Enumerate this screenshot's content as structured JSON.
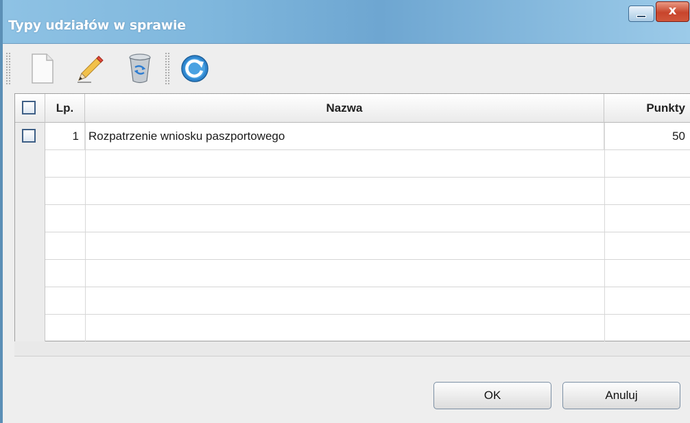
{
  "window": {
    "title": "Typy udziałów w sprawie",
    "close_glyph": "x"
  },
  "toolbar": {
    "buttons": [
      {
        "icon": "new-document-icon"
      },
      {
        "icon": "edit-pencil-icon"
      },
      {
        "icon": "recycle-bin-icon"
      },
      {
        "icon": "refresh-icon"
      }
    ]
  },
  "table": {
    "columns": [
      "Lp.",
      "Nazwa",
      "Punkty"
    ],
    "rows": [
      {
        "lp": "1",
        "nazwa": "Rozpatrzenie wniosku paszportowego",
        "punkty": "50"
      }
    ]
  },
  "buttons": {
    "ok_label": "OK",
    "cancel_label": "Anuluj"
  },
  "colors": {
    "titlebar": "#7fb7dd",
    "accent": "#3e5f86"
  }
}
